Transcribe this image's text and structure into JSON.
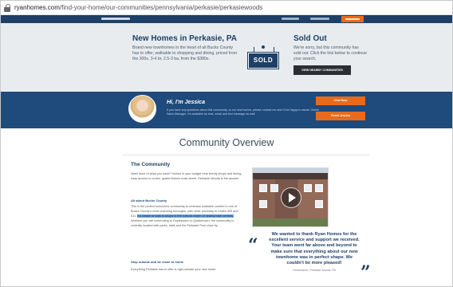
{
  "address_bar": {
    "domain": "ryanhomes.com",
    "path": "/find-your-home/our-communities/pennsylvania/perkasie/perkasiewoods"
  },
  "hero": {
    "title": "New Homes in Perkasie, PA",
    "description": "Brand new townhomes in the heart of all Bucks County has to offer, walkable to shopping and dining, priced from the 300s. 3-4 br, 2.5-3 ba, from the $380s.",
    "sign_text": "SOLD",
    "sold_title": "Sold Out",
    "sold_text": "We're sorry, but this community has sold out. Click the link below to continue your search.",
    "button": "VIEW NEARBY COMMUNITIES"
  },
  "agent": {
    "greeting": "Hi, I'm Jessica",
    "text": "If you have any questions about this community, or our new homes, please contact me and I'll be happy to assist. Online Sales Manager, I'm available by chat, email and text message as well.",
    "button_primary": "Chat Now",
    "button_secondary": "Email Jessica"
  },
  "overview": {
    "title": "Community Overview",
    "section_title": "The Community",
    "para1": "Want more of what you want? Homes in your budget near trendy shops and dining, easy access to routes, quaint historic main street. Perkasie Woods is the answer.",
    "sub1": "All about Bucks County",
    "para2_a": "This is the perfect townhome community to embrace walkable comfort in one of Bucks County's most charming boroughs, with close proximity to routes 309 and 611.",
    "para2_highlight": "It's simple to walk to shops in the cultural charm of nearby town centers.",
    "para2_b": "Whether you are commuting to Doylestown or Quakertown, the community is centrally located with parks, trails and the Perkasie Pool close by.",
    "sub2": "Step outside and be close to home",
    "para3": "Everything Perkasie has to offer is right outside your new home."
  },
  "testimonial": {
    "open_quote": "“",
    "close_quote": "”",
    "text": "We wanted to thank Ryan Homes for the excellent service and support we received. Your team went far above and beyond to make sure that everything about our new townhome was in perfect shape. We couldn't be more pleased!",
    "author": "Homeowner, Perkasie Woods, PA"
  }
}
